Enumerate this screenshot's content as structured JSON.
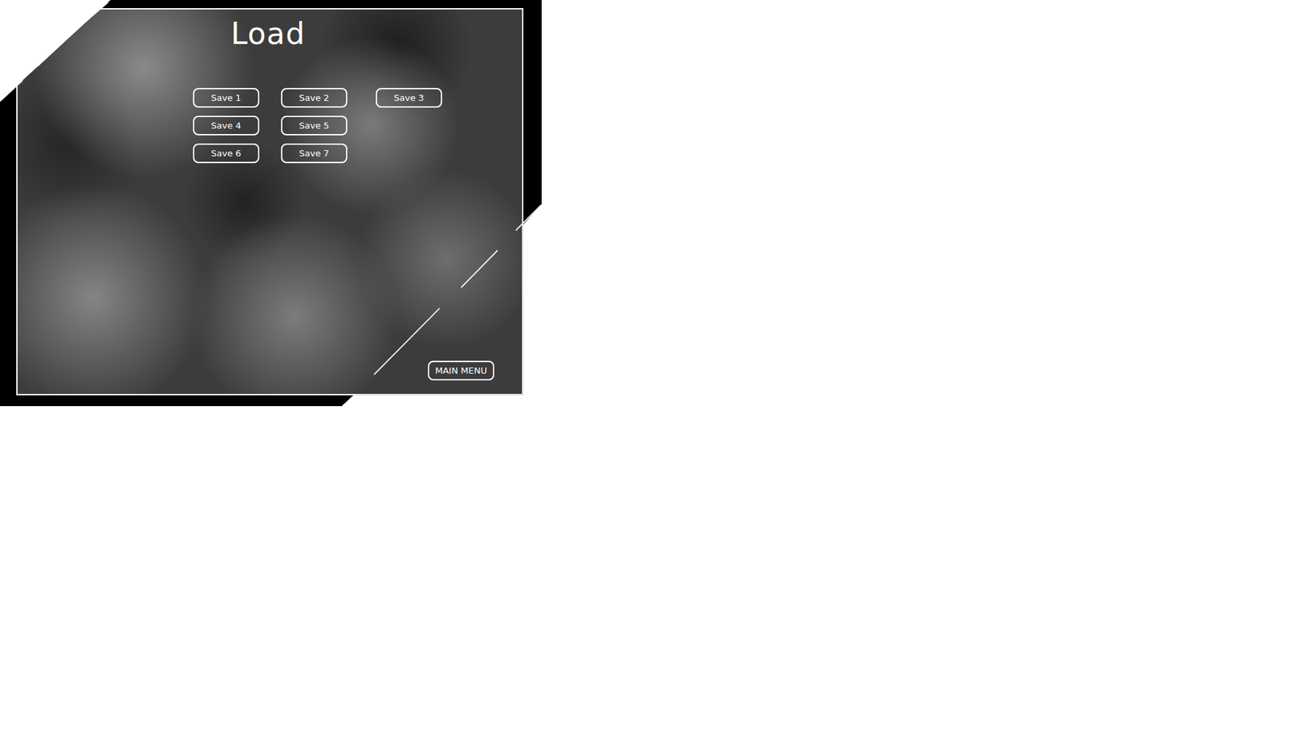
{
  "title": "Load",
  "saves": [
    [
      "Save 1",
      "Save 2",
      "Save 3"
    ],
    [
      "Save 4",
      "Save 5"
    ],
    [
      "Save 6",
      "Save 7"
    ]
  ],
  "main_menu": "MAIN MENU"
}
